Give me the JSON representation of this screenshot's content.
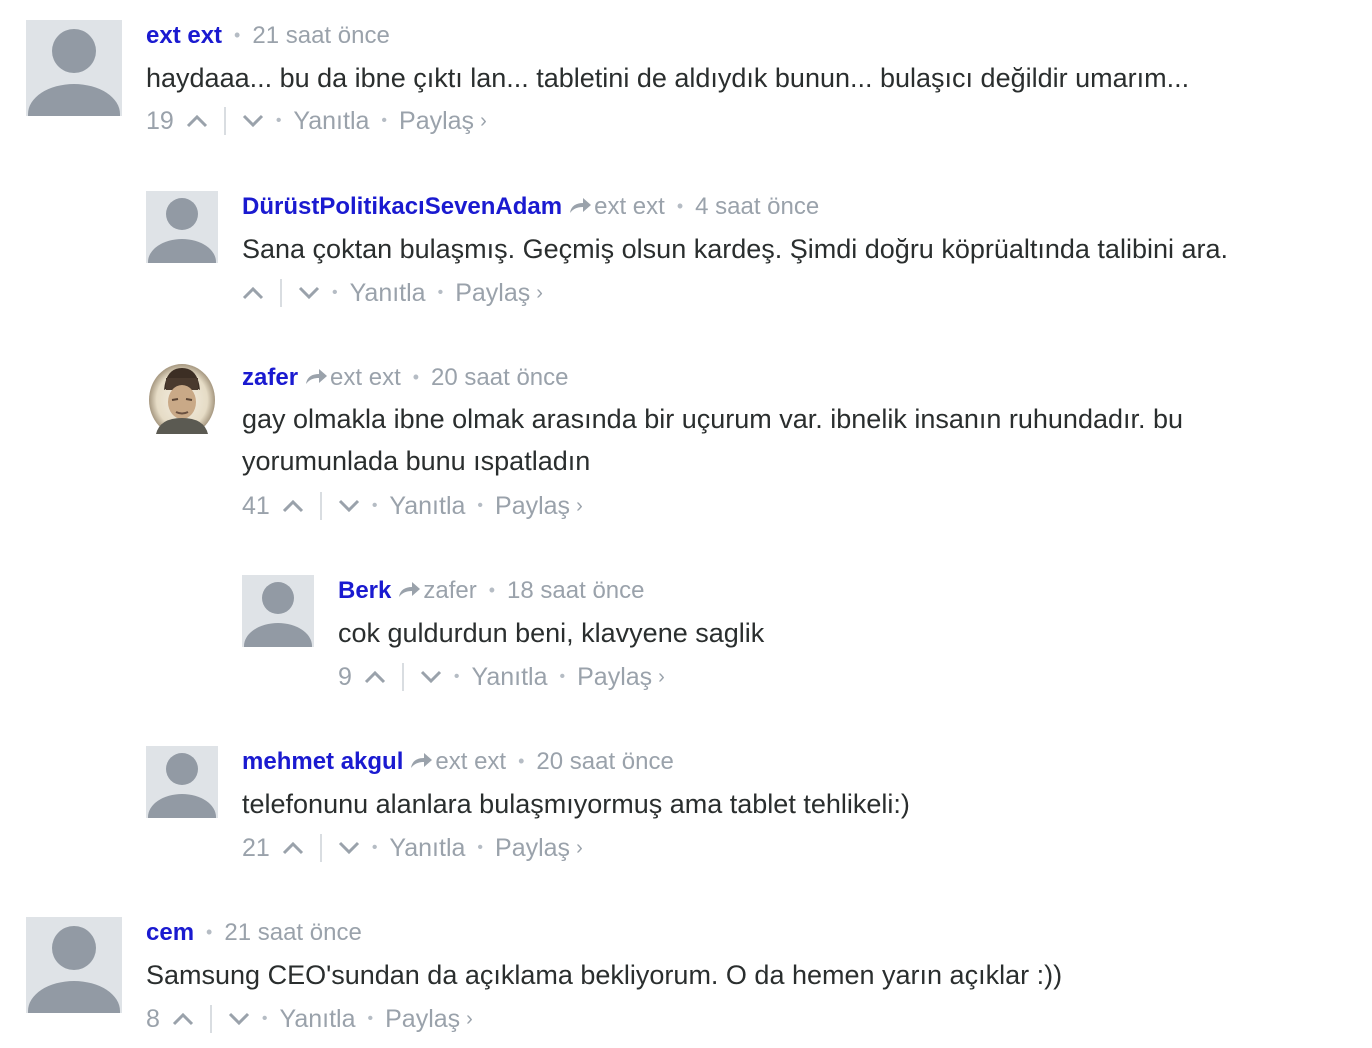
{
  "comments": [
    {
      "author": "ext ext",
      "reply_to": "",
      "time": "21 saat önce",
      "text": "haydaaa... bu da ibne çıktı lan... tabletini de aldıydık bunun... bulaşıcı değildir umarım...",
      "votes": "19",
      "reply_label": "Yanıtla",
      "share_label": "Paylaş",
      "avatar": "default-avatar"
    },
    {
      "author": "DürüstPolitikacıSevenAdam",
      "reply_to": "ext ext",
      "time": "4 saat önce",
      "text": "Sana çoktan bulaşmış. Geçmiş olsun kardeş. Şimdi doğru köprüaltında talibini ara.",
      "votes": "",
      "reply_label": "Yanıtla",
      "share_label": "Paylaş",
      "avatar": "default-avatar"
    },
    {
      "author": "zafer",
      "reply_to": "ext ext",
      "time": "20 saat önce",
      "text_line1": "gay olmakla ibne olmak arasında bir uçurum var. ibnelik insanın ruhundadır. bu",
      "text_line2": "yorumunlada bunu ıspatladın",
      "votes": "41",
      "reply_label": "Yanıtla",
      "share_label": "Paylaş",
      "avatar": "portrait-photo"
    },
    {
      "author": "Berk",
      "reply_to": "zafer",
      "time": "18 saat önce",
      "text": "cok guldurdun beni, klavyene saglik",
      "votes": "9",
      "reply_label": "Yanıtla",
      "share_label": "Paylaş",
      "avatar": "default-avatar"
    },
    {
      "author": "mehmet akgul",
      "reply_to": "ext ext",
      "time": "20 saat önce",
      "text": "telefonunu alanlara bulaşmıyormuş ama tablet tehlikeli:)",
      "votes": "21",
      "reply_label": "Yanıtla",
      "share_label": "Paylaş",
      "avatar": "default-avatar"
    },
    {
      "author": "cem",
      "reply_to": "",
      "time": "21 saat önce",
      "text": "Samsung CEO'sundan da açıklama bekliyorum. O da hemen yarın açıklar :))",
      "votes": "8",
      "reply_label": "Yanıtla",
      "share_label": "Paylaş",
      "avatar": "default-avatar"
    }
  ],
  "colors": {
    "author": "#1a1ad0",
    "meta": "#9aa2ab",
    "text": "#2a2e2e",
    "avatar_bg": "#dfe3e7",
    "avatar_fg": "#929aa4"
  },
  "icons": {
    "upvote": "chevron-up-icon",
    "downvote": "chevron-down-icon",
    "reply_indicator": "reply-arrow-icon",
    "share": "chevron-right-icon"
  }
}
